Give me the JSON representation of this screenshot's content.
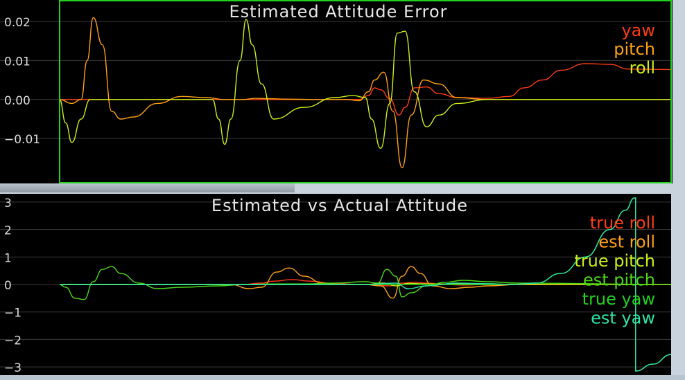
{
  "colors": {
    "background": "#c9d3de",
    "panel": "#000000",
    "grid": "#3a3a3a",
    "axis_text": "#dcdcdc",
    "title_text": "#e6e6e6",
    "frame_highlight": "#22d11e"
  },
  "chart_data": [
    {
      "type": "line",
      "title": "Estimated Attitude Error",
      "ylim": [
        -0.0215,
        0.0255
      ],
      "xlim": [
        0,
        1
      ],
      "yticks": [
        0.02,
        0.01,
        0.0,
        -0.01
      ],
      "ytick_labels": [
        "0.02",
        "0.01",
        "0.00",
        "−0.01"
      ],
      "grid": true,
      "legend": "top-right",
      "series": [
        {
          "name": "yaw",
          "color": "#ff3c14",
          "x": [
            0,
            0.45,
            0.49,
            0.505,
            0.515,
            0.525,
            0.54,
            0.555,
            0.565,
            0.58,
            0.6,
            0.62,
            0.65,
            0.7,
            0.735,
            0.76,
            0.79,
            0.82,
            0.86,
            0.9,
            0.93,
            1.0
          ],
          "y": [
            0,
            0,
            0,
            0.001,
            0.003,
            0.0025,
            0.0002,
            -0.004,
            -0.002,
            0.003,
            0.0032,
            0.0015,
            0.0005,
            0.0003,
            0.0008,
            0.003,
            0.005,
            0.0075,
            0.0092,
            0.009,
            0.0078,
            0.0077
          ]
        },
        {
          "name": "pitch",
          "color": "#ffa114",
          "x": [
            0,
            0.02,
            0.035,
            0.045,
            0.055,
            0.07,
            0.085,
            0.1,
            0.12,
            0.16,
            0.2,
            0.24,
            0.27,
            0.3,
            0.32,
            0.345,
            0.37,
            0.42,
            0.47,
            0.49,
            0.505,
            0.515,
            0.53,
            0.545,
            0.56,
            0.575,
            0.595,
            0.62,
            0.65,
            0.7,
            1.0
          ],
          "y": [
            0,
            -0.001,
            0.0,
            0.01,
            0.021,
            0.014,
            -0.003,
            -0.005,
            -0.0045,
            -0.001,
            0.0008,
            0.0005,
            0.0,
            0.0,
            0.0003,
            0.0002,
            0.0001,
            0.0,
            0.0,
            -0.0003,
            0.002,
            0.005,
            0.007,
            -0.003,
            -0.0175,
            -0.004,
            0.005,
            0.004,
            0.0005,
            0.0,
            0.0
          ]
        },
        {
          "name": "roll",
          "color": "#ccee18",
          "x": [
            0,
            0.01,
            0.02,
            0.035,
            0.05,
            0.07,
            0.1,
            0.2,
            0.25,
            0.26,
            0.27,
            0.28,
            0.295,
            0.305,
            0.315,
            0.33,
            0.35,
            0.4,
            0.45,
            0.48,
            0.5,
            0.51,
            0.525,
            0.54,
            0.552,
            0.565,
            0.58,
            0.6,
            0.62,
            0.65,
            0.7,
            1.0
          ],
          "y": [
            0,
            -0.006,
            -0.011,
            -0.005,
            0.0,
            0.0,
            0.0,
            0.0,
            0.0,
            -0.005,
            -0.0115,
            -0.005,
            0.01,
            0.0205,
            0.014,
            0.004,
            -0.005,
            -0.002,
            0.0005,
            0.001,
            0.0005,
            -0.005,
            -0.0125,
            -0.001,
            0.017,
            0.0175,
            0.002,
            -0.007,
            -0.004,
            -0.001,
            0.0,
            0.0
          ]
        }
      ]
    },
    {
      "type": "line",
      "title": "Estimated vs Actual Attitude",
      "ylim": [
        -3.3,
        3.3
      ],
      "xlim": [
        0,
        1
      ],
      "yticks": [
        3,
        2,
        1,
        0,
        -1,
        -2,
        -3
      ],
      "ytick_labels": [
        "3",
        "2",
        "1",
        "0",
        "−1",
        "−2",
        "−3"
      ],
      "grid": true,
      "legend": "top-right",
      "series": [
        {
          "name": "true roll",
          "color": "#ff3c14",
          "x": [
            0,
            0.3,
            0.33,
            0.35,
            0.38,
            0.41,
            0.45,
            0.5,
            0.54,
            0.56,
            0.58,
            0.6,
            0.63,
            0.66,
            0.7,
            1.0
          ],
          "y": [
            0,
            0,
            0.05,
            0.12,
            0.18,
            0.12,
            0.03,
            0,
            -0.05,
            0.05,
            0.08,
            0.05,
            0.0,
            -0.02,
            0,
            0
          ]
        },
        {
          "name": "est roll",
          "color": "#ffa114",
          "x": [
            0,
            0.28,
            0.31,
            0.33,
            0.355,
            0.375,
            0.4,
            0.43,
            0.46,
            0.5,
            0.525,
            0.545,
            0.56,
            0.575,
            0.59,
            0.61,
            0.64,
            0.67,
            0.7,
            0.75,
            1.0
          ],
          "y": [
            0,
            0,
            -0.15,
            -0.1,
            0.45,
            0.6,
            0.3,
            0.05,
            0,
            0,
            -0.05,
            -0.5,
            0.3,
            0.65,
            0.4,
            -0.05,
            -0.15,
            -0.1,
            -0.05,
            0,
            0
          ]
        },
        {
          "name": "true pitch",
          "color": "#ccee18",
          "x": [
            0,
            0.5,
            0.53,
            0.55,
            0.57,
            0.6,
            0.65,
            0.7,
            1.0
          ],
          "y": [
            0,
            0,
            0.05,
            -0.05,
            0.04,
            0.02,
            0.02,
            0.01,
            0
          ]
        },
        {
          "name": "est pitch",
          "color": "#4bd916",
          "x": [
            0,
            0.01,
            0.025,
            0.04,
            0.055,
            0.07,
            0.085,
            0.1,
            0.13,
            0.16,
            0.2,
            0.26,
            0.3,
            0.35,
            0.4,
            0.45,
            0.5,
            0.52,
            0.535,
            0.55,
            0.56,
            0.575,
            0.6,
            0.63,
            0.66,
            0.7,
            0.75,
            1.0
          ],
          "y": [
            0,
            -0.1,
            -0.5,
            -0.55,
            0.1,
            0.55,
            0.65,
            0.4,
            0.05,
            -0.15,
            -0.1,
            -0.05,
            0,
            0.02,
            0.02,
            0.05,
            0.1,
            0.05,
            0.55,
            0.3,
            -0.45,
            -0.3,
            -0.05,
            0.08,
            0.15,
            0.1,
            0.05,
            0
          ]
        },
        {
          "name": "true yaw",
          "color": "#22d11e",
          "x": [
            0,
            0.74,
            0.78,
            0.82,
            0.86,
            0.9,
            0.925,
            0.94,
            0.942,
            0.97,
            1.0
          ],
          "y": [
            0,
            0,
            0.05,
            0.4,
            1.0,
            2.0,
            2.7,
            3.15,
            -3.15,
            -2.9,
            -2.55
          ]
        },
        {
          "name": "est yaw",
          "color": "#2ee6a8",
          "x": [
            0,
            0.5,
            0.55,
            0.57,
            0.6,
            0.65,
            0.7,
            0.74,
            0.78,
            0.82,
            0.86,
            0.9,
            0.925,
            0.94,
            0.942,
            0.97,
            1.0
          ],
          "y": [
            0,
            0,
            0.05,
            -0.15,
            -0.05,
            0.05,
            0.03,
            0,
            0.05,
            0.4,
            1.0,
            2.0,
            2.7,
            3.15,
            -3.15,
            -2.9,
            -2.55
          ]
        }
      ]
    }
  ]
}
